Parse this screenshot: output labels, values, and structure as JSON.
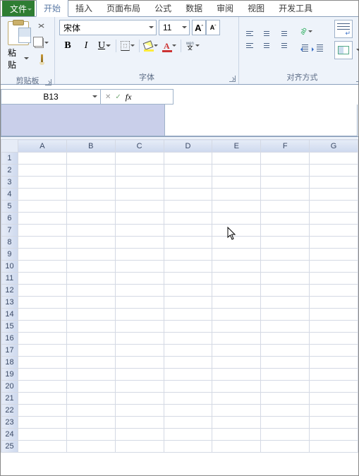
{
  "tabs": {
    "file": "文件",
    "home": "开始",
    "insert": "插入",
    "layout": "页面布局",
    "formula": "公式",
    "data": "数据",
    "review": "审阅",
    "view": "视图",
    "dev": "开发工具"
  },
  "groups": {
    "clipboard": "剪贴板",
    "font": "字体",
    "alignment": "对齐方式"
  },
  "clipboard": {
    "paste": "粘贴"
  },
  "font": {
    "name": "宋体",
    "size": "11",
    "grow": "A",
    "shrink": "A",
    "bold": "B",
    "italic": "I",
    "underline": "U",
    "color_char": "A"
  },
  "namebox": {
    "cell": "B13",
    "fx": "fx"
  },
  "columns": [
    "A",
    "B",
    "C",
    "D",
    "E",
    "F",
    "G"
  ],
  "rows": [
    "1",
    "2",
    "3",
    "4",
    "5",
    "6",
    "7",
    "8",
    "9",
    "10",
    "11",
    "12",
    "13",
    "14",
    "15",
    "16",
    "17",
    "18",
    "19",
    "20",
    "21",
    "22",
    "23",
    "24",
    "25"
  ]
}
